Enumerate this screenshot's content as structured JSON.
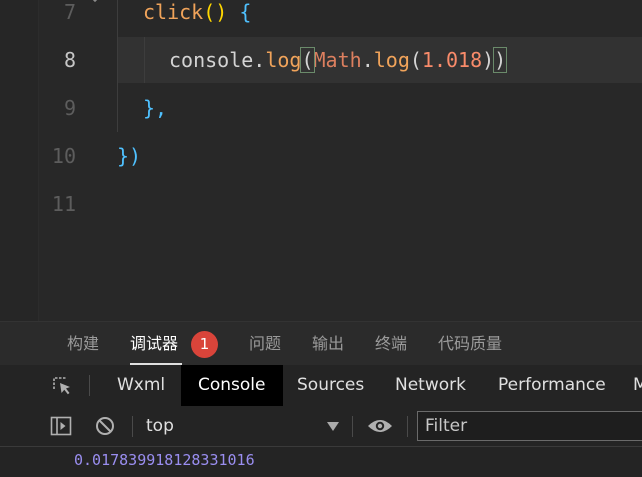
{
  "editor": {
    "line_numbers": [
      "7",
      "8",
      "9",
      "10",
      "11"
    ],
    "active_line": "8",
    "lines": {
      "l7": {
        "fn": "click",
        "parens": "()",
        "brace": "{"
      },
      "l8": {
        "obj": "console",
        "dot": ".",
        "method": "log",
        "open": "(",
        "math": "Math",
        "dot2": ".",
        "method2": "log",
        "open2": "(",
        "num": "1.018",
        "close2": ")",
        "close": ")"
      },
      "l9": {
        "text": "},"
      },
      "l10": {
        "text": "})"
      }
    }
  },
  "panel_tabs": {
    "items": [
      "构建",
      "调试器",
      "问题",
      "输出",
      "终端",
      "代码质量"
    ],
    "active": "调试器",
    "badge": "1"
  },
  "devtools_tabs": {
    "items": [
      "Wxml",
      "Console",
      "Sources",
      "Network",
      "Performance",
      "M"
    ],
    "active": "Console"
  },
  "console_toolbar": {
    "context": "top",
    "filter_placeholder": "Filter"
  },
  "console_output": {
    "value": "0.017839918128331016"
  },
  "colors": {
    "editor_bg": "#282828",
    "badge_bg": "#d9443a",
    "log_value": "#9a8ef0",
    "function_name": "#f0a35a"
  },
  "icons": [
    "chevron-down-icon",
    "inspect-element-icon",
    "sidebar-toggle-icon",
    "clear-console-icon",
    "eye-icon"
  ]
}
